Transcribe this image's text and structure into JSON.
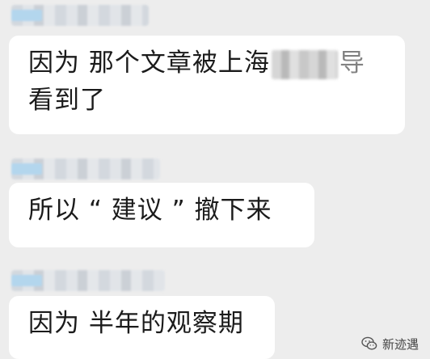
{
  "messages": [
    {
      "text_before": "因为 那个文章被上海",
      "redacted_tail": "导",
      "text_line2": "看到了"
    },
    {
      "text": "所以 “ 建议 ” 撤下来"
    },
    {
      "text": "因为 半年的观察期"
    }
  ],
  "watermark": {
    "label": "新迹遇",
    "icon": "wechat-icon"
  }
}
